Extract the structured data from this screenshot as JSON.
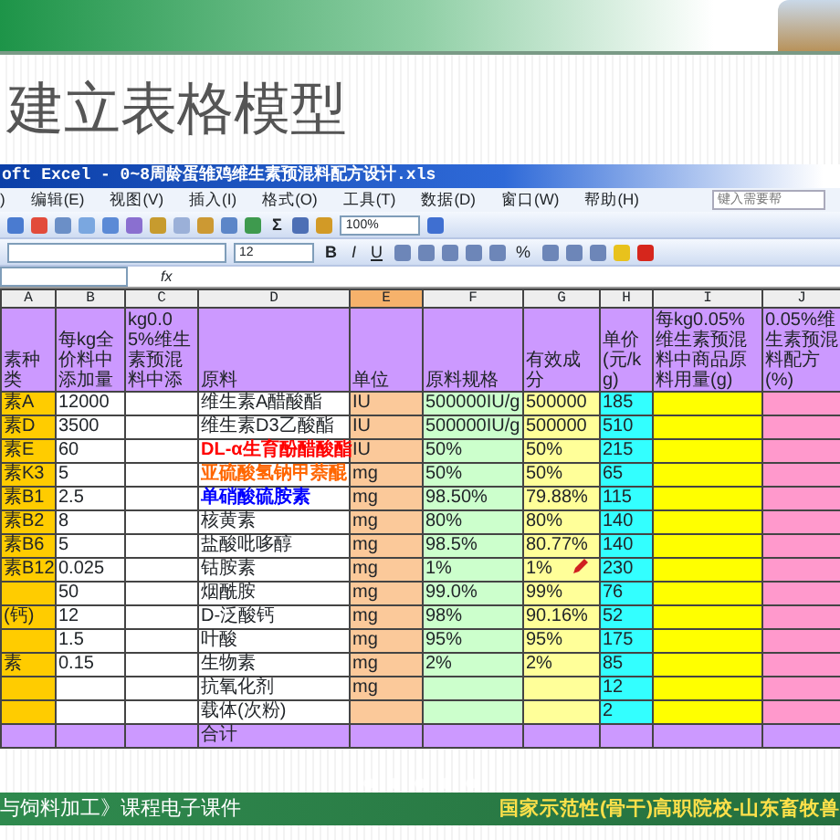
{
  "slide_title": "建立表格模型",
  "window": {
    "title": "oft Excel - 0~8周龄蛋雏鸡维生素预混料配方设计.xls"
  },
  "menu": [
    ")",
    "编辑(E)",
    "视图(V)",
    "插入(I)",
    "格式(O)",
    "工具(T)",
    "数据(D)",
    "窗口(W)",
    "帮助(H)"
  ],
  "help_box": {
    "placeholder": "键入需要帮"
  },
  "standard_toolbar": {
    "sum": "Σ",
    "zoom": "100%"
  },
  "format_toolbar": {
    "font_size": "12",
    "buttons": [
      "B",
      "I",
      "U"
    ],
    "percent": "%"
  },
  "formula_bar": {
    "function_label": "fx"
  },
  "columns": [
    {
      "letter": "A",
      "heading": "素种类",
      "selected": false
    },
    {
      "letter": "B",
      "heading": "每kg全价料中添加量",
      "selected": false
    },
    {
      "letter": "C",
      "heading": "kg0.05%维生素预混料中添",
      "selected": false
    },
    {
      "letter": "D",
      "heading": "原料",
      "selected": false
    },
    {
      "letter": "E",
      "heading": "单位",
      "selected": true
    },
    {
      "letter": "F",
      "heading": "原料规格",
      "selected": false
    },
    {
      "letter": "G",
      "heading": "有效成分",
      "selected": false
    },
    {
      "letter": "H",
      "heading": "单价(元/kg)",
      "selected": false
    },
    {
      "letter": "I",
      "heading": "每kg0.05%维生素预混料中商品原料用量(g)",
      "selected": false
    },
    {
      "letter": "J",
      "heading": "0.05%维生素预混料配方(%)",
      "selected": false
    }
  ],
  "rows": [
    {
      "kind": "data",
      "a": "素A",
      "b": "12000",
      "d": "维生素A醋酸酯",
      "e": "IU",
      "f": "500000IU/g",
      "g": "500000",
      "h": "185"
    },
    {
      "kind": "data",
      "a": "素D",
      "b": "3500",
      "d": "维生素D3乙酸酯",
      "e": "IU",
      "f": "500000IU/g",
      "g": "500000",
      "h": "510"
    },
    {
      "kind": "data",
      "a": "素E",
      "b": "60",
      "d": "DL-α生育酚醋酸酯",
      "color": "#ff0000",
      "e": "IU",
      "f": "50%",
      "g": "50%",
      "h": "215"
    },
    {
      "kind": "data",
      "a": "素K3",
      "b": "5",
      "d": "亚硫酸氢钠甲萘醌",
      "color": "#ff6600",
      "e": "mg",
      "f": "50%",
      "g": "50%",
      "h": "65"
    },
    {
      "kind": "data",
      "a": "素B1",
      "b": "2.5",
      "d": "单硝酸硫胺素",
      "color": "#0000ff",
      "e": "mg",
      "f": "98.50%",
      "g": "79.88%",
      "h": "115"
    },
    {
      "kind": "data",
      "a": "素B2",
      "b": "8",
      "d": "核黄素",
      "e": "mg",
      "f": "80%",
      "g": "80%",
      "h": "140"
    },
    {
      "kind": "data",
      "a": "素B6",
      "b": "5",
      "d": "盐酸吡哆醇",
      "e": "mg",
      "f": "98.5%",
      "g": "80.77%",
      "h": "140"
    },
    {
      "kind": "data",
      "a": "素B12",
      "b": "0.025",
      "d": "钴胺素",
      "e": "mg",
      "f": "1%",
      "g": "1%",
      "h": "230"
    },
    {
      "kind": "data",
      "b": "50",
      "d": "烟酰胺",
      "e": "mg",
      "f": "99.0%",
      "g": "99%",
      "h": "76"
    },
    {
      "kind": "data",
      "a": "(钙)",
      "b": "12",
      "d": "D-泛酸钙",
      "e": "mg",
      "f": "98%",
      "g": "90.16%",
      "h": "52"
    },
    {
      "kind": "data",
      "b": "1.5",
      "d": "叶酸",
      "e": "mg",
      "f": "95%",
      "g": "95%",
      "h": "175"
    },
    {
      "kind": "data",
      "a": "素",
      "b": "0.15",
      "d": "生物素",
      "e": "mg",
      "f": "2%",
      "g": "2%",
      "h": "85"
    },
    {
      "kind": "data",
      "d": "抗氧化剂",
      "e": "mg",
      "h": "12"
    },
    {
      "kind": "data",
      "d": "载体(次粉)",
      "h": "2"
    },
    {
      "kind": "total",
      "d": "合计"
    }
  ],
  "footer": {
    "left": "与饲料加工》课程电子课件",
    "right": "国家示范性(骨干)高职院校-山东畜牧兽"
  }
}
